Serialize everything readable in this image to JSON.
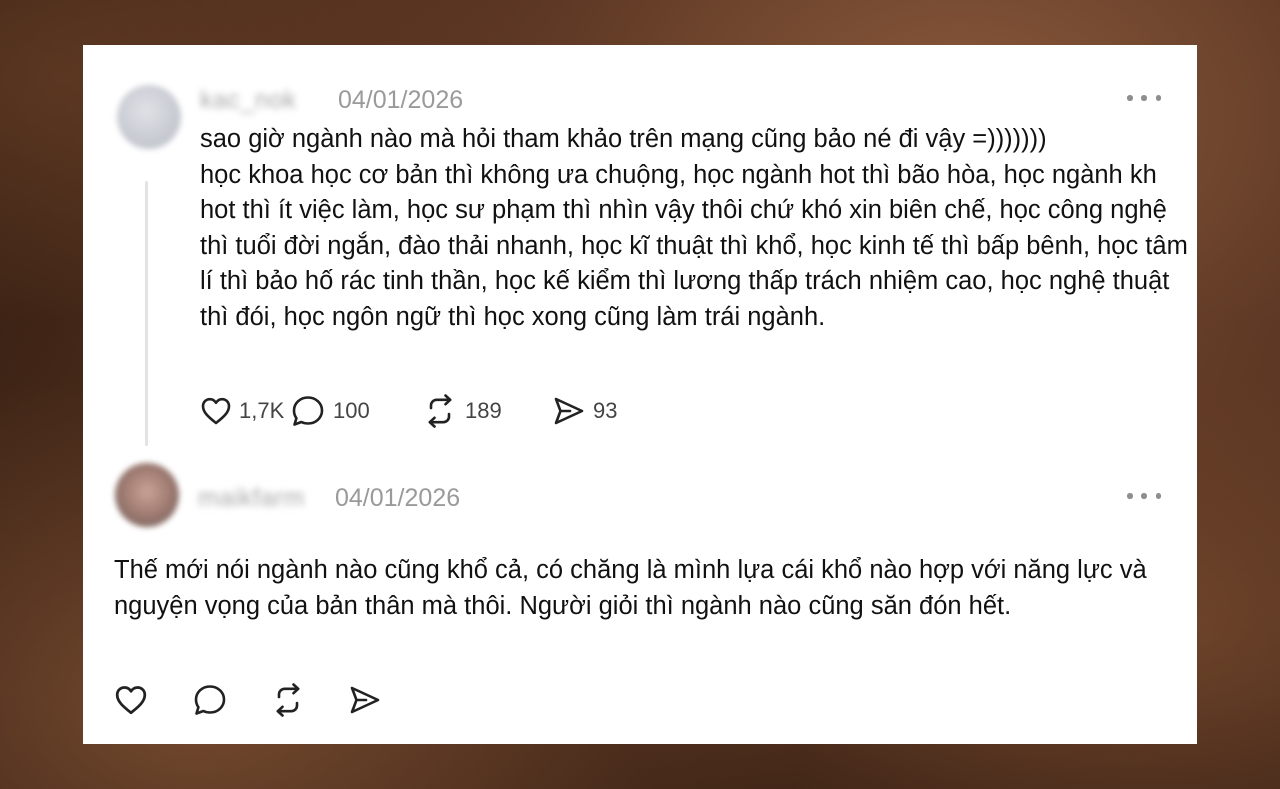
{
  "thread": {
    "post": {
      "username": "kac_nok",
      "date": "04/01/2026",
      "text": "sao giờ ngành nào mà hỏi tham khảo trên mạng cũng bảo né đi vậy =)))))))\nhọc khoa học cơ bản thì không ưa chuộng, học ngành hot thì bão hòa, học ngành kh hot thì ít việc làm, học sư phạm thì nhìn vậy thôi chứ khó xin biên chế, học công nghệ thì tuổi đời ngắn, đào thải nhanh, học kĩ thuật thì khổ, học kinh tế thì bấp bênh, học tâm lí thì bảo hố rác tinh thần, học kế kiểm thì lương thấp trách nhiệm cao, học nghệ thuật thì đói, học ngôn ngữ thì học xong cũng làm trái ngành.",
      "likes": "1,7K",
      "replies": "100",
      "reposts": "189",
      "shares": "93"
    },
    "reply": {
      "username": "maikfarm",
      "date": "04/01/2026",
      "text": "Thế mới nói ngành nào cũng khổ cả, có chăng là mình lựa cái khổ nào hợp với năng lực và nguyện vọng của bản thân mà thôi. Người giỏi thì ngành nào cũng săn đón hết."
    }
  },
  "icons": {
    "like": "heart-icon",
    "reply": "comment-bubble-icon",
    "repost": "repost-arrows-icon",
    "share": "send-icon",
    "more": "more-dots-icon"
  }
}
